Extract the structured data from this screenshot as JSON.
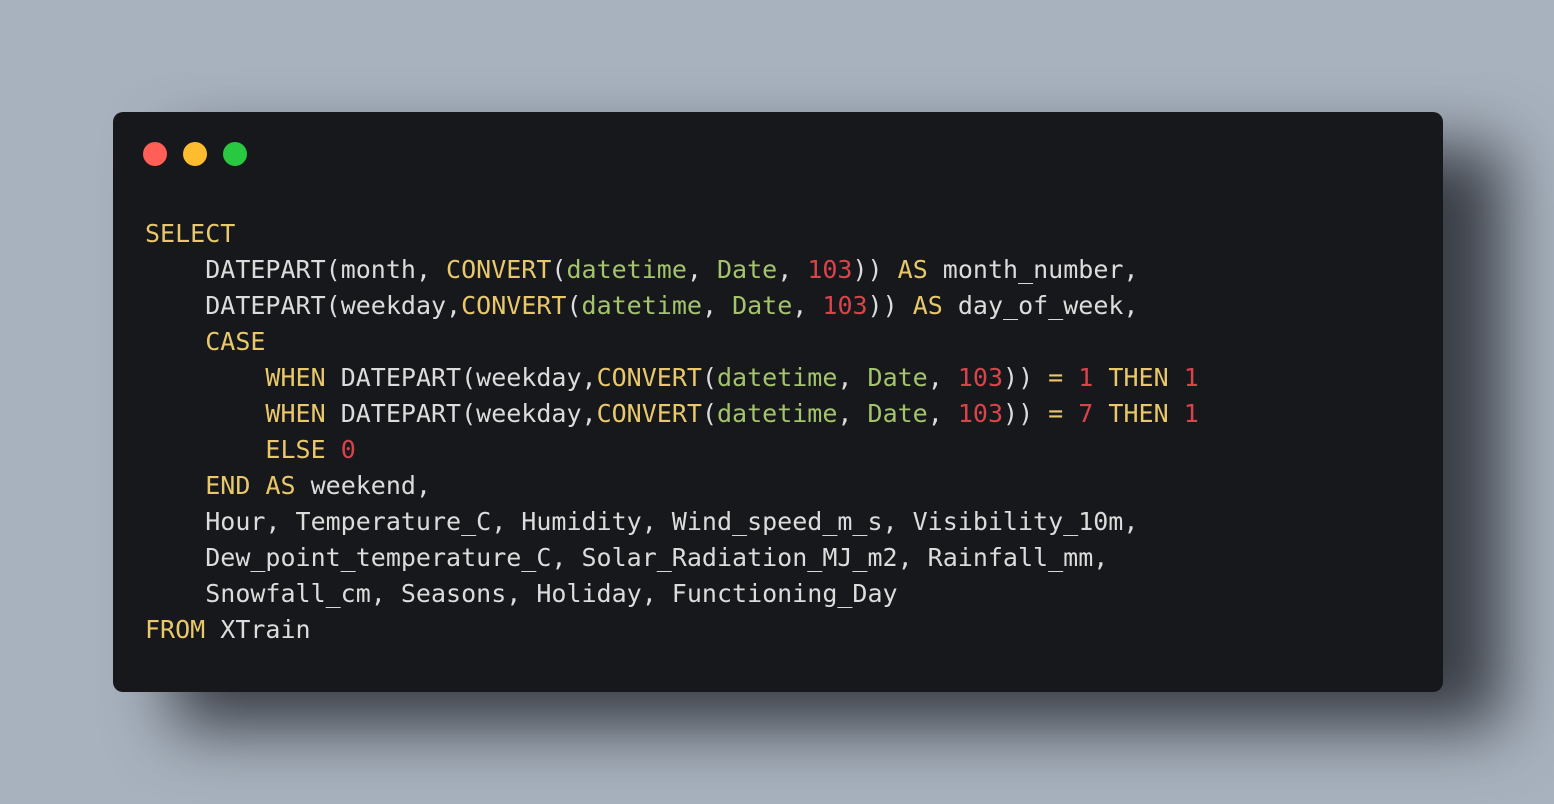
{
  "window": {
    "controls": [
      {
        "name": "close",
        "color": "#ff5f57"
      },
      {
        "name": "minimize",
        "color": "#febc2e"
      },
      {
        "name": "maximize",
        "color": "#28c840"
      }
    ]
  },
  "colors": {
    "background": "#a8b2be",
    "editor_bg": "#17181b",
    "keyword": "#e8c86b",
    "string": "#a3c46c",
    "number": "#d9434b",
    "text": "#dcdcdc"
  },
  "code": {
    "language": "sql",
    "lines": [
      {
        "indent": 0,
        "tokens": [
          {
            "t": "SELECT",
            "c": "kw"
          }
        ]
      },
      {
        "indent": 1,
        "tokens": [
          {
            "t": "DATEPART(",
            "c": "fn"
          },
          {
            "t": "month, ",
            "c": "id"
          },
          {
            "t": "CONVERT",
            "c": "kw"
          },
          {
            "t": "(",
            "c": "p"
          },
          {
            "t": "datetime",
            "c": "str"
          },
          {
            "t": ", ",
            "c": "p"
          },
          {
            "t": "Date",
            "c": "str"
          },
          {
            "t": ", ",
            "c": "p"
          },
          {
            "t": "103",
            "c": "num"
          },
          {
            "t": ")) ",
            "c": "p"
          },
          {
            "t": "AS",
            "c": "kw"
          },
          {
            "t": " month_number,",
            "c": "id"
          }
        ]
      },
      {
        "indent": 1,
        "tokens": [
          {
            "t": "DATEPART(",
            "c": "fn"
          },
          {
            "t": "weekday,",
            "c": "id"
          },
          {
            "t": "CONVERT",
            "c": "kw"
          },
          {
            "t": "(",
            "c": "p"
          },
          {
            "t": "datetime",
            "c": "str"
          },
          {
            "t": ", ",
            "c": "p"
          },
          {
            "t": "Date",
            "c": "str"
          },
          {
            "t": ", ",
            "c": "p"
          },
          {
            "t": "103",
            "c": "num"
          },
          {
            "t": ")) ",
            "c": "p"
          },
          {
            "t": "AS",
            "c": "kw"
          },
          {
            "t": " day_of_week,",
            "c": "id"
          }
        ]
      },
      {
        "indent": 1,
        "tokens": [
          {
            "t": "CASE",
            "c": "kw"
          }
        ]
      },
      {
        "indent": 2,
        "tokens": [
          {
            "t": "WHEN",
            "c": "kw"
          },
          {
            "t": " DATEPART(",
            "c": "fn"
          },
          {
            "t": "weekday,",
            "c": "id"
          },
          {
            "t": "CONVERT",
            "c": "kw"
          },
          {
            "t": "(",
            "c": "p"
          },
          {
            "t": "datetime",
            "c": "str"
          },
          {
            "t": ", ",
            "c": "p"
          },
          {
            "t": "Date",
            "c": "str"
          },
          {
            "t": ", ",
            "c": "p"
          },
          {
            "t": "103",
            "c": "num"
          },
          {
            "t": ")) ",
            "c": "p"
          },
          {
            "t": "=",
            "c": "kw"
          },
          {
            "t": " ",
            "c": "p"
          },
          {
            "t": "1",
            "c": "num"
          },
          {
            "t": " ",
            "c": "p"
          },
          {
            "t": "THEN",
            "c": "kw"
          },
          {
            "t": " ",
            "c": "p"
          },
          {
            "t": "1",
            "c": "num"
          }
        ]
      },
      {
        "indent": 2,
        "tokens": [
          {
            "t": "WHEN",
            "c": "kw"
          },
          {
            "t": " DATEPART(",
            "c": "fn"
          },
          {
            "t": "weekday,",
            "c": "id"
          },
          {
            "t": "CONVERT",
            "c": "kw"
          },
          {
            "t": "(",
            "c": "p"
          },
          {
            "t": "datetime",
            "c": "str"
          },
          {
            "t": ", ",
            "c": "p"
          },
          {
            "t": "Date",
            "c": "str"
          },
          {
            "t": ", ",
            "c": "p"
          },
          {
            "t": "103",
            "c": "num"
          },
          {
            "t": ")) ",
            "c": "p"
          },
          {
            "t": "=",
            "c": "kw"
          },
          {
            "t": " ",
            "c": "p"
          },
          {
            "t": "7",
            "c": "num"
          },
          {
            "t": " ",
            "c": "p"
          },
          {
            "t": "THEN",
            "c": "kw"
          },
          {
            "t": " ",
            "c": "p"
          },
          {
            "t": "1",
            "c": "num"
          }
        ]
      },
      {
        "indent": 2,
        "tokens": [
          {
            "t": "ELSE",
            "c": "kw"
          },
          {
            "t": " ",
            "c": "p"
          },
          {
            "t": "0",
            "c": "num"
          }
        ]
      },
      {
        "indent": 1,
        "tokens": [
          {
            "t": "END",
            "c": "kw"
          },
          {
            "t": " ",
            "c": "p"
          },
          {
            "t": "AS",
            "c": "kw"
          },
          {
            "t": " weekend,",
            "c": "id"
          }
        ]
      },
      {
        "indent": 1,
        "tokens": [
          {
            "t": "Hour, Temperature_C, Humidity, Wind_speed_m_s, Visibility_10m,",
            "c": "id"
          }
        ]
      },
      {
        "indent": 1,
        "tokens": [
          {
            "t": "Dew_point_temperature_C, Solar_Radiation_MJ_m2, Rainfall_mm,",
            "c": "id"
          }
        ]
      },
      {
        "indent": 1,
        "tokens": [
          {
            "t": "Snowfall_cm, Seasons, Holiday, Functioning_Day",
            "c": "id"
          }
        ]
      },
      {
        "indent": 0,
        "tokens": [
          {
            "t": "FROM",
            "c": "kw"
          },
          {
            "t": " XTrain",
            "c": "id"
          }
        ]
      }
    ]
  }
}
